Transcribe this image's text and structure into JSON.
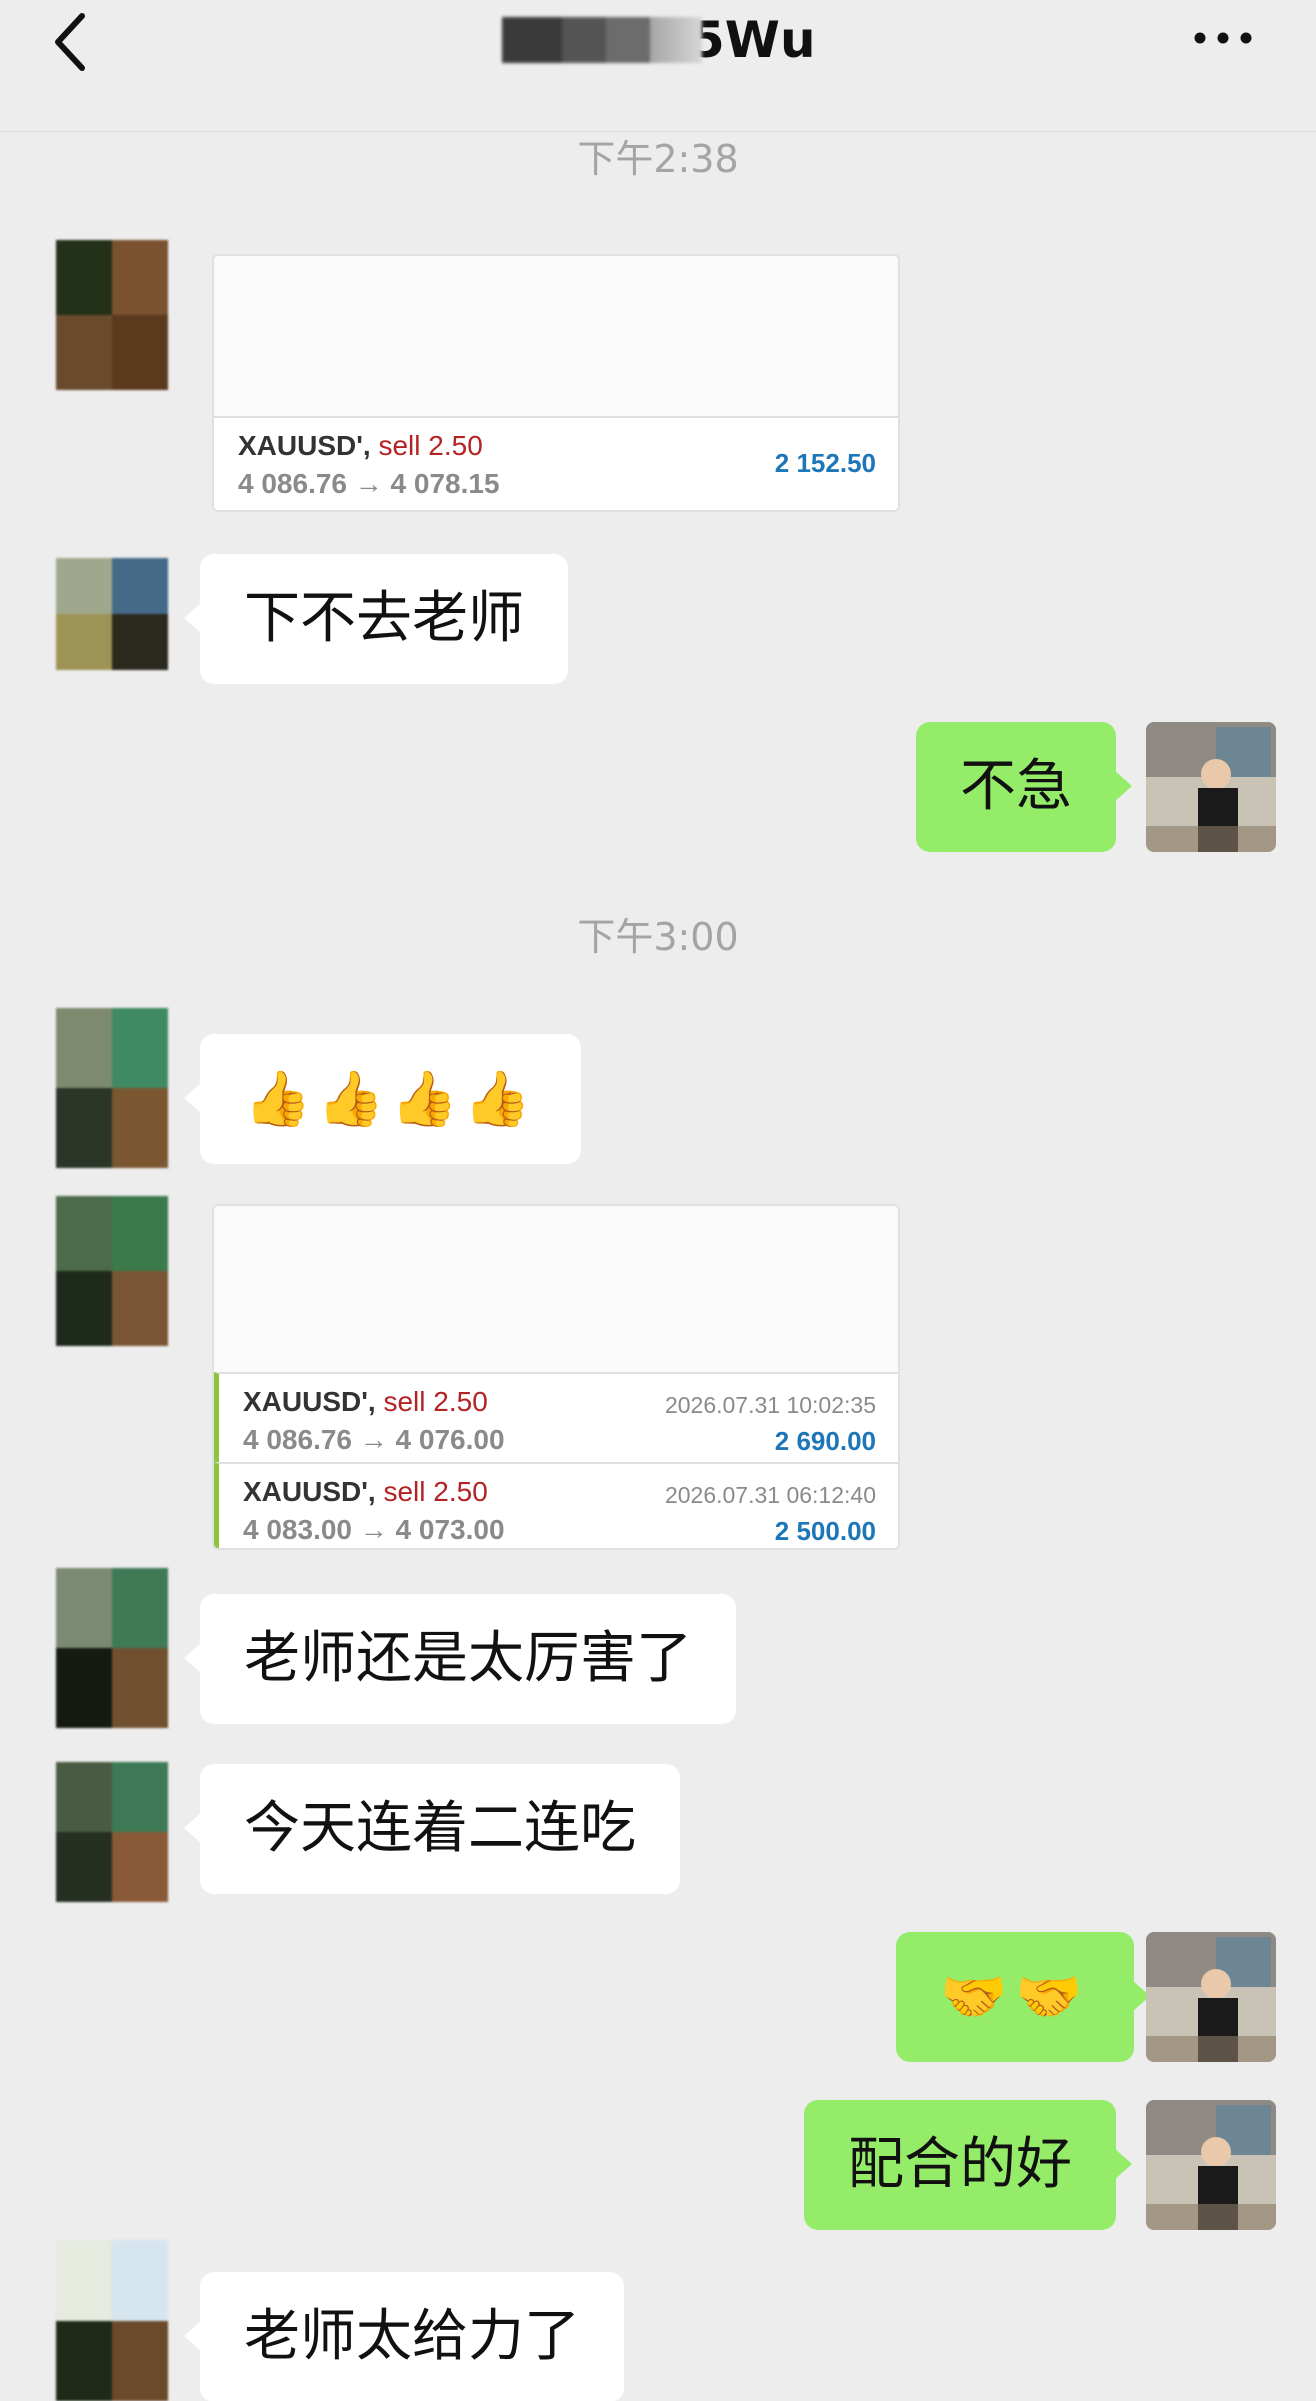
{
  "header": {
    "title_suffix": "5Wu",
    "back_icon": "chevron-left-icon",
    "more_icon": "more-dots-icon"
  },
  "timestamps": [
    "下午2:38",
    "下午3:00"
  ],
  "cards": [
    {
      "rows": [
        {
          "symbol": "XAUUSD'",
          "side": "sell",
          "volume": "2.50",
          "prices": "4 086.76 → 4 078.15",
          "date": "",
          "profit": "2 152.50"
        }
      ]
    },
    {
      "rows": [
        {
          "symbol": "XAUUSD'",
          "side": "sell",
          "volume": "2.50",
          "prices": "4 086.76 → 4 076.00",
          "date": "2026.07.31 10:02:35",
          "profit": "2 690.00"
        },
        {
          "symbol": "XAUUSD'",
          "side": "sell",
          "volume": "2.50",
          "prices": "4 083.00 → 4 073.00",
          "date": "2026.07.31 06:12:40",
          "profit": "2 500.00"
        }
      ]
    }
  ],
  "messages": {
    "m1": "下不去老师",
    "m2": "不急",
    "m3": "👍👍👍👍",
    "m4": "老师还是太厉害了",
    "m5": "今天连着二连吃",
    "m6": "🤝🤝",
    "m7": "配合的好",
    "m8": "老师太给力了"
  },
  "colors": {
    "background": "#ededed",
    "self_bubble": "#95ec69",
    "other_bubble": "#ffffff",
    "sell": "#b42323",
    "profit": "#1d76b8",
    "accent_bar": "#8cc63f"
  }
}
